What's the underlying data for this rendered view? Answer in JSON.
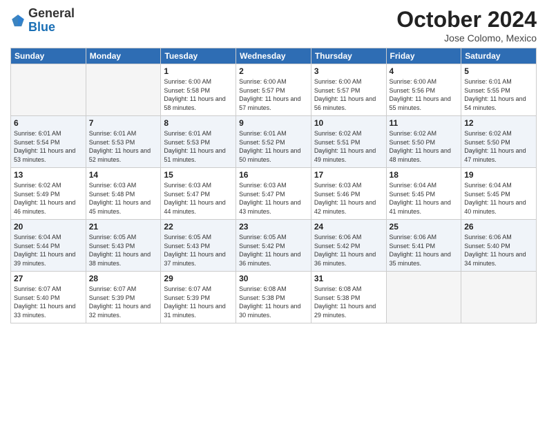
{
  "header": {
    "logo_general": "General",
    "logo_blue": "Blue",
    "month_title": "October 2024",
    "location": "Jose Colomo, Mexico"
  },
  "days_of_week": [
    "Sunday",
    "Monday",
    "Tuesday",
    "Wednesday",
    "Thursday",
    "Friday",
    "Saturday"
  ],
  "weeks": [
    [
      {
        "day": "",
        "info": ""
      },
      {
        "day": "",
        "info": ""
      },
      {
        "day": "1",
        "info": "Sunrise: 6:00 AM\nSunset: 5:58 PM\nDaylight: 11 hours and 58 minutes."
      },
      {
        "day": "2",
        "info": "Sunrise: 6:00 AM\nSunset: 5:57 PM\nDaylight: 11 hours and 57 minutes."
      },
      {
        "day": "3",
        "info": "Sunrise: 6:00 AM\nSunset: 5:57 PM\nDaylight: 11 hours and 56 minutes."
      },
      {
        "day": "4",
        "info": "Sunrise: 6:00 AM\nSunset: 5:56 PM\nDaylight: 11 hours and 55 minutes."
      },
      {
        "day": "5",
        "info": "Sunrise: 6:01 AM\nSunset: 5:55 PM\nDaylight: 11 hours and 54 minutes."
      }
    ],
    [
      {
        "day": "6",
        "info": "Sunrise: 6:01 AM\nSunset: 5:54 PM\nDaylight: 11 hours and 53 minutes."
      },
      {
        "day": "7",
        "info": "Sunrise: 6:01 AM\nSunset: 5:53 PM\nDaylight: 11 hours and 52 minutes."
      },
      {
        "day": "8",
        "info": "Sunrise: 6:01 AM\nSunset: 5:53 PM\nDaylight: 11 hours and 51 minutes."
      },
      {
        "day": "9",
        "info": "Sunrise: 6:01 AM\nSunset: 5:52 PM\nDaylight: 11 hours and 50 minutes."
      },
      {
        "day": "10",
        "info": "Sunrise: 6:02 AM\nSunset: 5:51 PM\nDaylight: 11 hours and 49 minutes."
      },
      {
        "day": "11",
        "info": "Sunrise: 6:02 AM\nSunset: 5:50 PM\nDaylight: 11 hours and 48 minutes."
      },
      {
        "day": "12",
        "info": "Sunrise: 6:02 AM\nSunset: 5:50 PM\nDaylight: 11 hours and 47 minutes."
      }
    ],
    [
      {
        "day": "13",
        "info": "Sunrise: 6:02 AM\nSunset: 5:49 PM\nDaylight: 11 hours and 46 minutes."
      },
      {
        "day": "14",
        "info": "Sunrise: 6:03 AM\nSunset: 5:48 PM\nDaylight: 11 hours and 45 minutes."
      },
      {
        "day": "15",
        "info": "Sunrise: 6:03 AM\nSunset: 5:47 PM\nDaylight: 11 hours and 44 minutes."
      },
      {
        "day": "16",
        "info": "Sunrise: 6:03 AM\nSunset: 5:47 PM\nDaylight: 11 hours and 43 minutes."
      },
      {
        "day": "17",
        "info": "Sunrise: 6:03 AM\nSunset: 5:46 PM\nDaylight: 11 hours and 42 minutes."
      },
      {
        "day": "18",
        "info": "Sunrise: 6:04 AM\nSunset: 5:45 PM\nDaylight: 11 hours and 41 minutes."
      },
      {
        "day": "19",
        "info": "Sunrise: 6:04 AM\nSunset: 5:45 PM\nDaylight: 11 hours and 40 minutes."
      }
    ],
    [
      {
        "day": "20",
        "info": "Sunrise: 6:04 AM\nSunset: 5:44 PM\nDaylight: 11 hours and 39 minutes."
      },
      {
        "day": "21",
        "info": "Sunrise: 6:05 AM\nSunset: 5:43 PM\nDaylight: 11 hours and 38 minutes."
      },
      {
        "day": "22",
        "info": "Sunrise: 6:05 AM\nSunset: 5:43 PM\nDaylight: 11 hours and 37 minutes."
      },
      {
        "day": "23",
        "info": "Sunrise: 6:05 AM\nSunset: 5:42 PM\nDaylight: 11 hours and 36 minutes."
      },
      {
        "day": "24",
        "info": "Sunrise: 6:06 AM\nSunset: 5:42 PM\nDaylight: 11 hours and 36 minutes."
      },
      {
        "day": "25",
        "info": "Sunrise: 6:06 AM\nSunset: 5:41 PM\nDaylight: 11 hours and 35 minutes."
      },
      {
        "day": "26",
        "info": "Sunrise: 6:06 AM\nSunset: 5:40 PM\nDaylight: 11 hours and 34 minutes."
      }
    ],
    [
      {
        "day": "27",
        "info": "Sunrise: 6:07 AM\nSunset: 5:40 PM\nDaylight: 11 hours and 33 minutes."
      },
      {
        "day": "28",
        "info": "Sunrise: 6:07 AM\nSunset: 5:39 PM\nDaylight: 11 hours and 32 minutes."
      },
      {
        "day": "29",
        "info": "Sunrise: 6:07 AM\nSunset: 5:39 PM\nDaylight: 11 hours and 31 minutes."
      },
      {
        "day": "30",
        "info": "Sunrise: 6:08 AM\nSunset: 5:38 PM\nDaylight: 11 hours and 30 minutes."
      },
      {
        "day": "31",
        "info": "Sunrise: 6:08 AM\nSunset: 5:38 PM\nDaylight: 11 hours and 29 minutes."
      },
      {
        "day": "",
        "info": ""
      },
      {
        "day": "",
        "info": ""
      }
    ]
  ]
}
